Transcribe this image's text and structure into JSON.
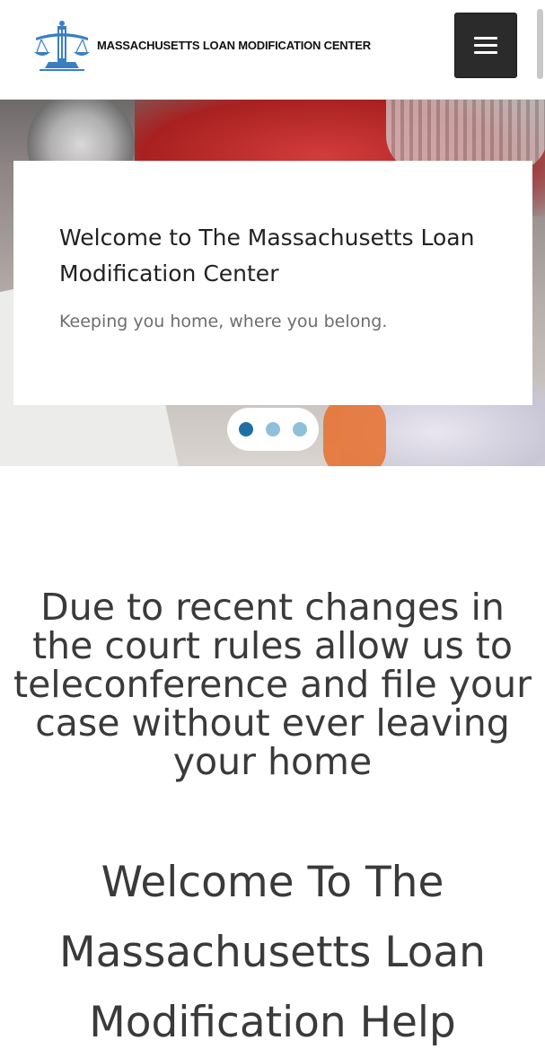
{
  "header": {
    "logo_text": "MASSACHUSETTS LOAN MODIFICATION CENTER",
    "logo_icon": "scales-of-justice-icon",
    "menu_icon": "hamburger-menu-icon"
  },
  "hero": {
    "title": "Welcome to The Massachusetts Loan Modification Center",
    "subtitle": "Keeping you home, where you belong.",
    "slide_count": 3,
    "active_slide": 1
  },
  "main": {
    "notice": "Due to recent changes in the court rules allow us to teleconference and file your case without ever leaving your home",
    "welcome_heading": "Welcome To The Massachusetts Loan Modification Help"
  },
  "colors": {
    "logo_blue": "#3a7fc4",
    "menu_button": "#2b2b2b",
    "dot_active": "#1f6fa3",
    "dot_inactive": "#8ec0dc",
    "heading_text": "#3a3a3a"
  }
}
